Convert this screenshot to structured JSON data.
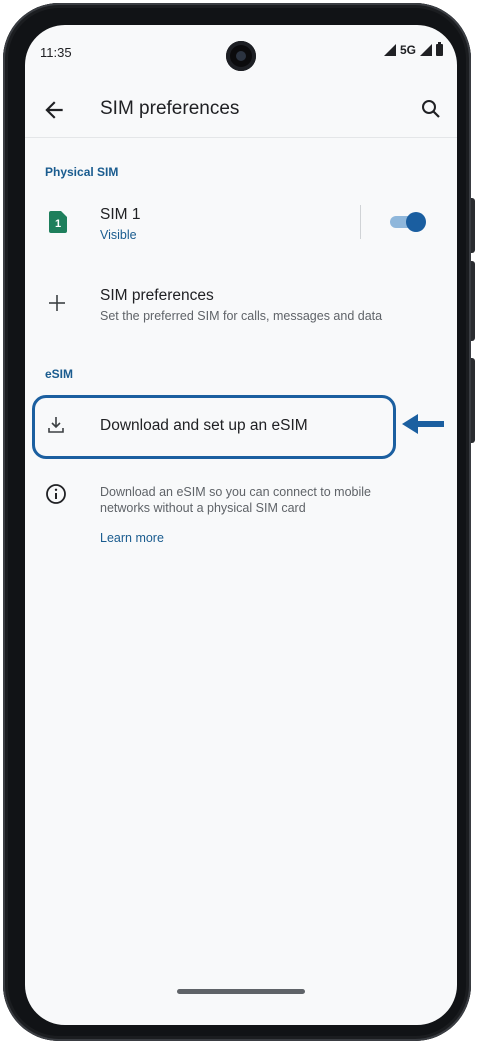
{
  "status": {
    "time": "11:35",
    "network": "5G"
  },
  "appbar": {
    "title": "SIM preferences"
  },
  "physical_sim": {
    "section_label": "Physical SIM",
    "sim1": {
      "badge": "1",
      "title": "SIM 1",
      "subtitle": "Visible",
      "toggle_on": true
    },
    "prefs": {
      "title": "SIM preferences",
      "subtitle": "Set the preferred SIM for calls, messages and data"
    }
  },
  "esim": {
    "section_label": "eSIM",
    "download_label": "Download and set up an eSIM",
    "info_line1": "Download an eSIM so you can connect to mobile",
    "info_line2": "networks without a physical SIM card",
    "learn_more": "Learn more"
  },
  "colors": {
    "accent": "#1a5c8f",
    "highlight": "#1b5fa0",
    "sim_badge": "#1e7f5c"
  },
  "icons": [
    "back-arrow-icon",
    "search-icon",
    "sim-card-icon",
    "plus-icon",
    "download-icon",
    "info-icon",
    "pointer-arrow-icon"
  ]
}
